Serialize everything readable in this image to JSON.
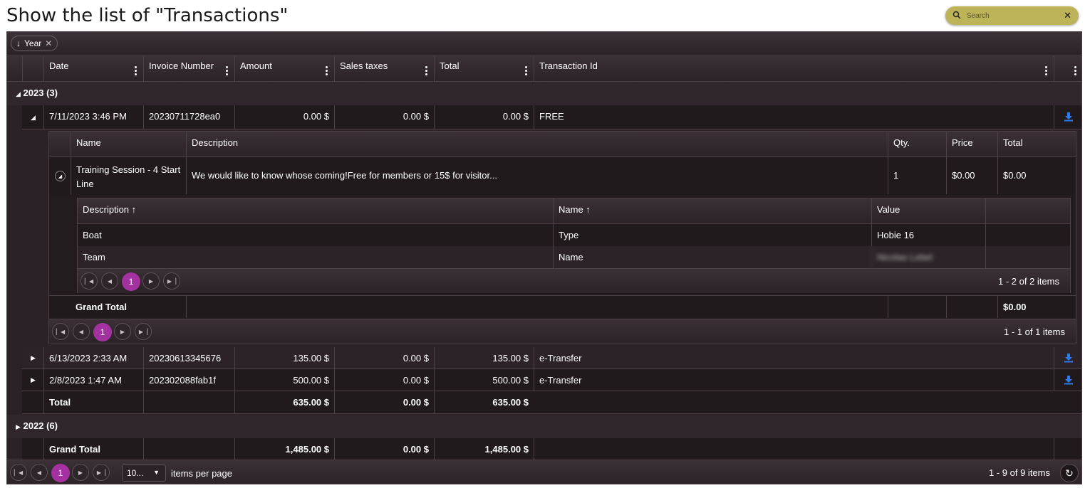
{
  "page": {
    "title": "Show the list of \"Transactions\""
  },
  "search": {
    "placeholder": "Search",
    "icon": "search-icon",
    "clear_icon": "close-icon"
  },
  "group_panel": {
    "chip_label": "Year",
    "chip_icon": "arrow-down-icon",
    "remove_icon": "close-icon"
  },
  "columns": [
    "Date",
    "Invoice Number",
    "Amount",
    "Sales taxes",
    "Total",
    "Transaction Id"
  ],
  "groups": [
    {
      "label": "2023 (3)",
      "expanded": true
    },
    {
      "label": "2022 (6)",
      "expanded": false
    }
  ],
  "rows": [
    {
      "date": "7/11/2023 3:46 PM",
      "invoice": "20230711728ea0",
      "amount": "0.00 $",
      "taxes": "0.00 $",
      "total": "0.00 $",
      "txid": "FREE"
    },
    {
      "date": "6/13/2023 2:33 AM",
      "invoice": "20230613345676",
      "amount": "135.00 $",
      "taxes": "0.00 $",
      "total": "135.00 $",
      "txid": "e-Transfer"
    },
    {
      "date": "2/8/2023 1:47 AM",
      "invoice": "202302088fab1f",
      "amount": "500.00 $",
      "taxes": "0.00 $",
      "total": "500.00 $",
      "txid": "e-Transfer"
    }
  ],
  "detail": {
    "columns": [
      "Name",
      "Description",
      "Qty.",
      "Price",
      "Total"
    ],
    "row": {
      "name_line1": "Training Session - 4 Start",
      "name_line2": "Line",
      "description": "We would like to know whose coming!Free for members or 15$ for visitor...",
      "qty": "1",
      "price": "$0.00",
      "total": "$0.00"
    },
    "attributes": {
      "columns": [
        "Description ↑",
        "Name ↑",
        "Value"
      ],
      "rows": [
        {
          "description": "Boat",
          "name": "Type",
          "value": "Hobie 16"
        },
        {
          "description": "Team",
          "name": "Name",
          "value": "Nicolas Lebel"
        }
      ],
      "pager": {
        "page": "1",
        "info": "1 - 2 of 2 items"
      }
    },
    "grand_total_label": "Grand Total",
    "grand_total_value": "$0.00",
    "pager": {
      "page": "1",
      "info": "1 - 1 of 1 items"
    }
  },
  "group_total": {
    "label": "Total",
    "amount": "635.00 $",
    "taxes": "0.00 $",
    "total": "635.00 $"
  },
  "grand_total": {
    "label": "Grand Total",
    "amount": "1,485.00 $",
    "taxes": "0.00 $",
    "total": "1,485.00 $"
  },
  "pager": {
    "page": "1",
    "page_size": "10...",
    "per_page_label": "items per page",
    "info": "1 - 9 of 9 items",
    "refresh_icon": "refresh-icon"
  },
  "colors": {
    "accent": "#a431a0",
    "search_bg": "#bdb45a",
    "download": "#2d7bf0",
    "grid_bg": "#2a2226"
  }
}
